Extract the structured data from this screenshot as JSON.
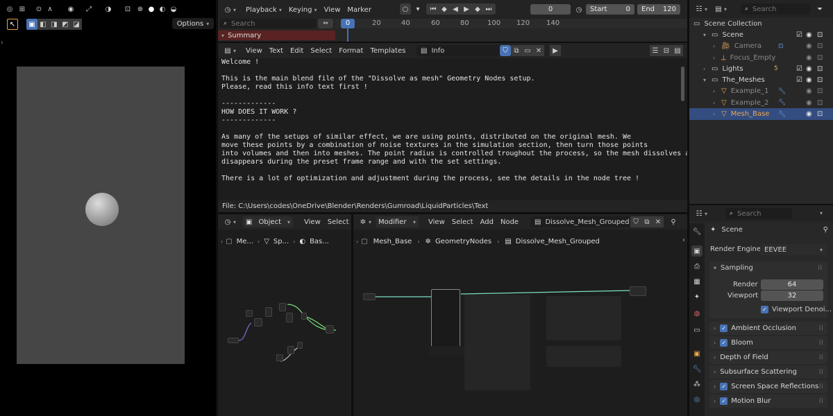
{
  "viewport": {
    "options_label": "Options"
  },
  "timeline": {
    "menu": [
      "Playback",
      "Keying",
      "View",
      "Marker"
    ],
    "current_frame": "0",
    "start_label": "Start",
    "start_value": "0",
    "end_label": "End",
    "end_value": "120",
    "search_placeholder": "Search",
    "summary_label": "Summary",
    "playhead": "0",
    "ruler": [
      "20",
      "40",
      "60",
      "80",
      "100",
      "120",
      "140"
    ]
  },
  "text_editor": {
    "menu": [
      "View",
      "Text",
      "Edit",
      "Select",
      "Format",
      "Templates"
    ],
    "datablock": "Info",
    "lines": [
      "Welcome !",
      "",
      "This is the main blend file of the \"Dissolve as mesh\" Geometry Nodes setup.",
      "Please, read this info text first !",
      "",
      "-------------",
      "HOW DOES IT WORK ?",
      "-------------",
      "",
      "As many of the setups of similar effect, we are using points, distributed on the original mesh. We",
      "move these points by a combination of noise textures in the simulation section, then turn those points",
      "into volumes and then into meshes. The point radius is controlled troughout the process, so the mesh dissolves and",
      "disappears during the preset frame range and with the set settings.",
      "",
      "There is a lot of optimization and adjustment during the process, see the details in the node tree !"
    ],
    "file_path": "File: C:\\Users\\codes\\OneDrive\\Blender\\Renders\\Gumroad\\LiquidParticles\\Text"
  },
  "node_left": {
    "mode": "Object",
    "menu": [
      "View",
      "Select"
    ],
    "breadcrumb": [
      "Me...",
      "Sp...",
      "Bas..."
    ]
  },
  "node_main": {
    "mode": "Modifier",
    "menu": [
      "View",
      "Select",
      "Add",
      "Node"
    ],
    "tree_name": "Dissolve_Mesh_Grouped",
    "breadcrumb": [
      "Mesh_Base",
      "GeometryNodes",
      "Dissolve_Mesh_Grouped"
    ]
  },
  "outliner": {
    "search_placeholder": "Search",
    "root": "Scene Collection",
    "items": [
      {
        "label": "Scene",
        "indent": 1,
        "type": "collection"
      },
      {
        "label": "Camera",
        "indent": 2,
        "type": "camera",
        "dim": true
      },
      {
        "label": "Focus_Empty",
        "indent": 2,
        "type": "empty",
        "dim": true
      },
      {
        "label": "Lights",
        "indent": 1,
        "type": "collection",
        "count": "5"
      },
      {
        "label": "The_Meshes",
        "indent": 1,
        "type": "collection"
      },
      {
        "label": "Example_1",
        "indent": 2,
        "type": "mesh",
        "dim": true
      },
      {
        "label": "Example_2",
        "indent": 2,
        "type": "mesh",
        "dim": true
      },
      {
        "label": "Mesh_Base",
        "indent": 2,
        "type": "mesh",
        "active": true
      }
    ]
  },
  "properties": {
    "search_placeholder": "Search",
    "context": "Scene",
    "render_engine_label": "Render Engine",
    "render_engine": "EEVEE",
    "sampling": {
      "label": "Sampling",
      "render_label": "Render",
      "render_value": "64",
      "viewport_label": "Viewport",
      "viewport_value": "32",
      "denoise_label": "Viewport Denoi..."
    },
    "panels": [
      {
        "label": "Ambient Occlusion",
        "checkbox": true
      },
      {
        "label": "Bloom",
        "checkbox": true
      },
      {
        "label": "Depth of Field",
        "checkbox": false
      },
      {
        "label": "Subsurface Scattering",
        "checkbox": false
      },
      {
        "label": "Screen Space Reflections",
        "checkbox": true
      },
      {
        "label": "Motion Blur",
        "checkbox": true
      }
    ]
  },
  "colors": {
    "accent": "#4772b3",
    "active_object": "#f0a64a",
    "summary_bar": "#5a2222",
    "node_link": "#7ee07e"
  }
}
